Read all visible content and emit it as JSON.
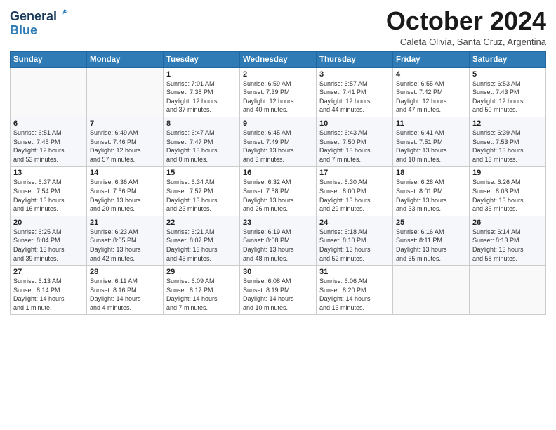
{
  "logo": {
    "line1": "General",
    "line2": "Blue"
  },
  "header": {
    "month": "October 2024",
    "location": "Caleta Olivia, Santa Cruz, Argentina"
  },
  "weekdays": [
    "Sunday",
    "Monday",
    "Tuesday",
    "Wednesday",
    "Thursday",
    "Friday",
    "Saturday"
  ],
  "weeks": [
    [
      {
        "day": "",
        "info": ""
      },
      {
        "day": "",
        "info": ""
      },
      {
        "day": "1",
        "info": "Sunrise: 7:01 AM\nSunset: 7:38 PM\nDaylight: 12 hours\nand 37 minutes."
      },
      {
        "day": "2",
        "info": "Sunrise: 6:59 AM\nSunset: 7:39 PM\nDaylight: 12 hours\nand 40 minutes."
      },
      {
        "day": "3",
        "info": "Sunrise: 6:57 AM\nSunset: 7:41 PM\nDaylight: 12 hours\nand 44 minutes."
      },
      {
        "day": "4",
        "info": "Sunrise: 6:55 AM\nSunset: 7:42 PM\nDaylight: 12 hours\nand 47 minutes."
      },
      {
        "day": "5",
        "info": "Sunrise: 6:53 AM\nSunset: 7:43 PM\nDaylight: 12 hours\nand 50 minutes."
      }
    ],
    [
      {
        "day": "6",
        "info": "Sunrise: 6:51 AM\nSunset: 7:45 PM\nDaylight: 12 hours\nand 53 minutes."
      },
      {
        "day": "7",
        "info": "Sunrise: 6:49 AM\nSunset: 7:46 PM\nDaylight: 12 hours\nand 57 minutes."
      },
      {
        "day": "8",
        "info": "Sunrise: 6:47 AM\nSunset: 7:47 PM\nDaylight: 13 hours\nand 0 minutes."
      },
      {
        "day": "9",
        "info": "Sunrise: 6:45 AM\nSunset: 7:49 PM\nDaylight: 13 hours\nand 3 minutes."
      },
      {
        "day": "10",
        "info": "Sunrise: 6:43 AM\nSunset: 7:50 PM\nDaylight: 13 hours\nand 7 minutes."
      },
      {
        "day": "11",
        "info": "Sunrise: 6:41 AM\nSunset: 7:51 PM\nDaylight: 13 hours\nand 10 minutes."
      },
      {
        "day": "12",
        "info": "Sunrise: 6:39 AM\nSunset: 7:53 PM\nDaylight: 13 hours\nand 13 minutes."
      }
    ],
    [
      {
        "day": "13",
        "info": "Sunrise: 6:37 AM\nSunset: 7:54 PM\nDaylight: 13 hours\nand 16 minutes."
      },
      {
        "day": "14",
        "info": "Sunrise: 6:36 AM\nSunset: 7:56 PM\nDaylight: 13 hours\nand 20 minutes."
      },
      {
        "day": "15",
        "info": "Sunrise: 6:34 AM\nSunset: 7:57 PM\nDaylight: 13 hours\nand 23 minutes."
      },
      {
        "day": "16",
        "info": "Sunrise: 6:32 AM\nSunset: 7:58 PM\nDaylight: 13 hours\nand 26 minutes."
      },
      {
        "day": "17",
        "info": "Sunrise: 6:30 AM\nSunset: 8:00 PM\nDaylight: 13 hours\nand 29 minutes."
      },
      {
        "day": "18",
        "info": "Sunrise: 6:28 AM\nSunset: 8:01 PM\nDaylight: 13 hours\nand 33 minutes."
      },
      {
        "day": "19",
        "info": "Sunrise: 6:26 AM\nSunset: 8:03 PM\nDaylight: 13 hours\nand 36 minutes."
      }
    ],
    [
      {
        "day": "20",
        "info": "Sunrise: 6:25 AM\nSunset: 8:04 PM\nDaylight: 13 hours\nand 39 minutes."
      },
      {
        "day": "21",
        "info": "Sunrise: 6:23 AM\nSunset: 8:05 PM\nDaylight: 13 hours\nand 42 minutes."
      },
      {
        "day": "22",
        "info": "Sunrise: 6:21 AM\nSunset: 8:07 PM\nDaylight: 13 hours\nand 45 minutes."
      },
      {
        "day": "23",
        "info": "Sunrise: 6:19 AM\nSunset: 8:08 PM\nDaylight: 13 hours\nand 48 minutes."
      },
      {
        "day": "24",
        "info": "Sunrise: 6:18 AM\nSunset: 8:10 PM\nDaylight: 13 hours\nand 52 minutes."
      },
      {
        "day": "25",
        "info": "Sunrise: 6:16 AM\nSunset: 8:11 PM\nDaylight: 13 hours\nand 55 minutes."
      },
      {
        "day": "26",
        "info": "Sunrise: 6:14 AM\nSunset: 8:13 PM\nDaylight: 13 hours\nand 58 minutes."
      }
    ],
    [
      {
        "day": "27",
        "info": "Sunrise: 6:13 AM\nSunset: 8:14 PM\nDaylight: 14 hours\nand 1 minute."
      },
      {
        "day": "28",
        "info": "Sunrise: 6:11 AM\nSunset: 8:16 PM\nDaylight: 14 hours\nand 4 minutes."
      },
      {
        "day": "29",
        "info": "Sunrise: 6:09 AM\nSunset: 8:17 PM\nDaylight: 14 hours\nand 7 minutes."
      },
      {
        "day": "30",
        "info": "Sunrise: 6:08 AM\nSunset: 8:19 PM\nDaylight: 14 hours\nand 10 minutes."
      },
      {
        "day": "31",
        "info": "Sunrise: 6:06 AM\nSunset: 8:20 PM\nDaylight: 14 hours\nand 13 minutes."
      },
      {
        "day": "",
        "info": ""
      },
      {
        "day": "",
        "info": ""
      }
    ]
  ]
}
